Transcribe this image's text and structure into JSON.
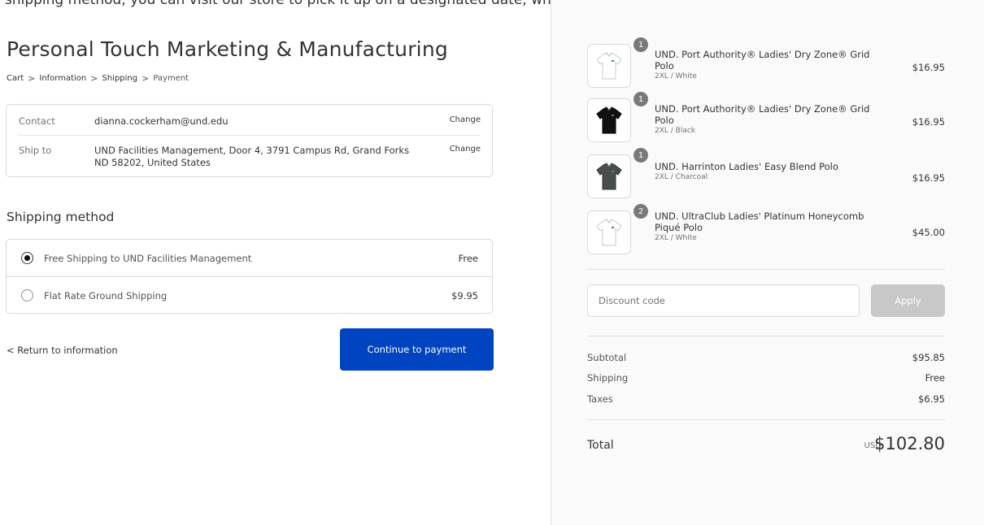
{
  "top_banner": "shipping method, you can visit our store to pick it up on a designated date, which will be",
  "shop": {
    "title": "Personal Touch Marketing & Manufacturing"
  },
  "breadcrumb": {
    "cart": "Cart",
    "information": "Information",
    "shipping": "Shipping",
    "payment": "Payment",
    "separator": ">"
  },
  "review": {
    "contact_label": "Contact",
    "contact_value": "dianna.cockerham@und.edu",
    "ship_to_label": "Ship to",
    "ship_to_value": "UND Facilities Management, Door 4, 3791 Campus Rd, Grand Forks ND 58202, United States",
    "change_label": "Change"
  },
  "shipping_method": {
    "heading": "Shipping method",
    "options": [
      {
        "name": "Free Shipping to UND Facilities Management",
        "price": "Free",
        "selected": true
      },
      {
        "name": "Flat Rate Ground Shipping",
        "price": "$9.95",
        "selected": false
      }
    ]
  },
  "actions": {
    "return_label": "< Return to information",
    "continue_label": "Continue to payment"
  },
  "order": {
    "items": [
      {
        "qty": "1",
        "name": "UND. Port Authority® Ladies' Dry Zone® Grid Polo",
        "variant": "2XL / White",
        "price": "$16.95",
        "shirt_color": "#ffffff"
      },
      {
        "qty": "1",
        "name": "UND. Port Authority® Ladies' Dry Zone® Grid Polo",
        "variant": "2XL / Black",
        "price": "$16.95",
        "shirt_color": "#111111"
      },
      {
        "qty": "1",
        "name": "UND. Harrinton Ladies' Easy Blend Polo",
        "variant": "2XL / Charcoal",
        "price": "$16.95",
        "shirt_color": "#4a4d4e"
      },
      {
        "qty": "2",
        "name": "UND. UltraClub Ladies' Platinum Honeycomb Piqué Polo",
        "variant": "2XL / White",
        "price": "$45.00",
        "shirt_color": "#ffffff"
      }
    ],
    "discount_placeholder": "Discount code",
    "apply_label": "Apply",
    "subtotal_label": "Subtotal",
    "subtotal_value": "$95.85",
    "shipping_label": "Shipping",
    "shipping_value": "Free",
    "taxes_label": "Taxes",
    "taxes_value": "$6.95",
    "total_label": "Total",
    "currency": "USD",
    "total_value": "$102.80"
  },
  "colors": {
    "primary_button": "#0044c1",
    "apply_disabled": "#c8c8c8",
    "sidebar_bg": "#fafafa",
    "logo_green": "#2e9d5c"
  }
}
